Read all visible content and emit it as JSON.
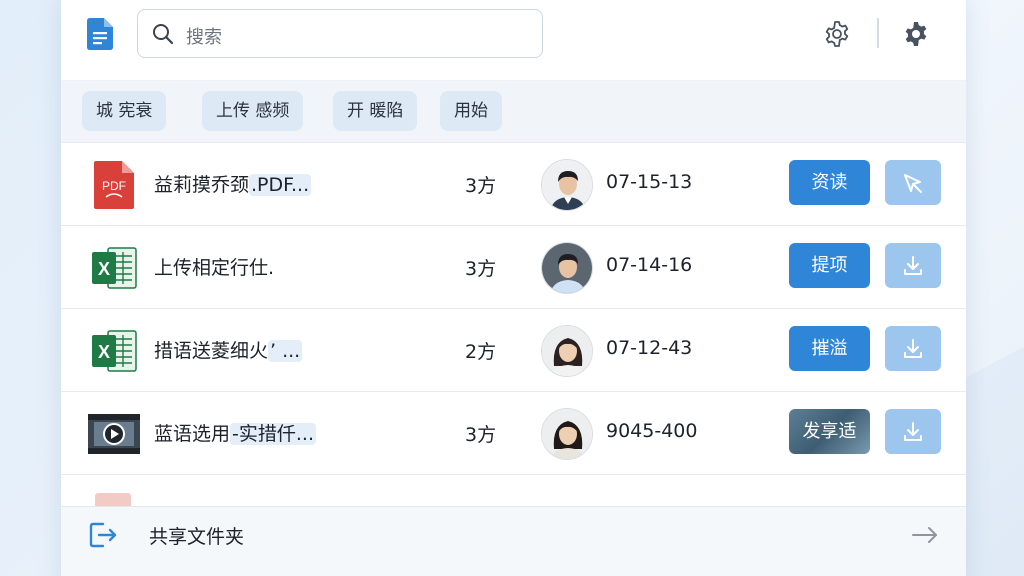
{
  "header": {
    "search": {
      "placeholder": "搜索"
    },
    "settings_icon": "gear-icon",
    "extension_icon": "puzzle-icon"
  },
  "chips": [
    {
      "label": "城  宪衰"
    },
    {
      "label": "上传  感频"
    },
    {
      "label": "开  暖陷"
    },
    {
      "label": "用始"
    }
  ],
  "files": [
    {
      "type": "pdf",
      "name_main": "益莉摸乔颈",
      "name_hl": ".PDF...",
      "count": "3方",
      "date": "07-15-13",
      "action": "资读",
      "action_style": "primary",
      "download_icon": "cursor-icon"
    },
    {
      "type": "excel",
      "name_main": "上传相定行仕.",
      "name_hl": "",
      "count": "3方",
      "date": "07-14-16",
      "action": "提项",
      "action_style": "primary",
      "download_icon": "download-icon"
    },
    {
      "type": "excel",
      "name_main": "措语送菱细火",
      "name_hl": "’ ...",
      "count": "2方",
      "date": "07-12-43",
      "action": "摧溢",
      "action_style": "primary",
      "download_icon": "download-icon"
    },
    {
      "type": "video",
      "name_main": "蓝语选用",
      "name_hl": "-实措仟...",
      "count": "3方",
      "date": "9045-400",
      "action": "发享适",
      "action_style": "video",
      "download_icon": "download-icon"
    }
  ],
  "footer": {
    "label": "共享文件夹",
    "icon": "exit-icon",
    "arrow_icon": "arrow-right-icon"
  },
  "colors": {
    "primary": "#2f86d8",
    "download_bg": "#9cc6ee",
    "chip_bg": "#dde9f5"
  }
}
